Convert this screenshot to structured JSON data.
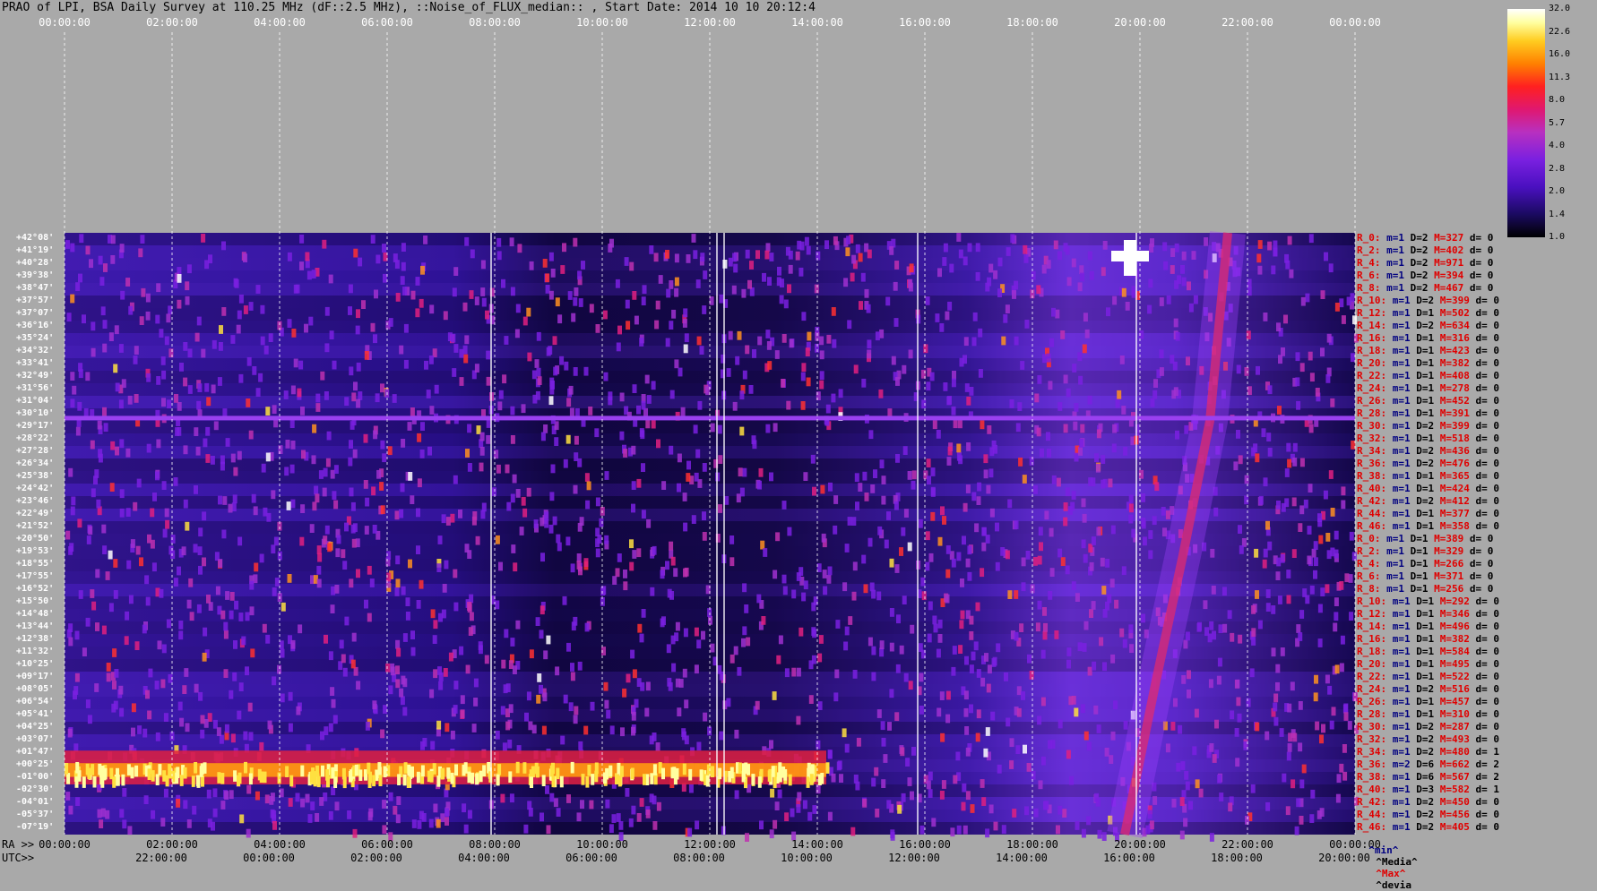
{
  "title": "PRAO of LPI, BSA Daily Survey at 110.25 MHz (dF::2.5 MHz), ::Noise_of_FLUX_median:: , Start Date: 2014 10 10 20:12:4",
  "chart_data": {
    "type": "heatmap",
    "title": "PRAO of LPI, BSA Daily Survey at 110.25 MHz (dF::2.5 MHz), ::Noise_of_FLUX_median:: , Start Date: 2014 10 10 20:12:4",
    "x_top_ticks": [
      "00:00:00",
      "02:00:00",
      "04:00:00",
      "06:00:00",
      "08:00:00",
      "10:00:00",
      "12:00:00",
      "14:00:00",
      "16:00:00",
      "18:00:00",
      "20:00:00",
      "22:00:00",
      "00:00:00"
    ],
    "x_ra_label": "RA >>",
    "x_ra_ticks": [
      "00:00:00",
      "02:00:00",
      "04:00:00",
      "06:00:00",
      "08:00:00",
      "10:00:00",
      "12:00:00",
      "14:00:00",
      "16:00:00",
      "18:00:00",
      "20:00:00",
      "22:00:00",
      "00:00:00"
    ],
    "x_utc_label": "UTC>>",
    "x_utc_ticks": [
      "22:00:00",
      "00:00:00",
      "02:00:00",
      "04:00:00",
      "06:00:00",
      "08:00:00",
      "10:00:00",
      "12:00:00",
      "14:00:00",
      "16:00:00",
      "18:00:00",
      "20:00:00"
    ],
    "y_dec_ticks": [
      "+42°08'",
      "+41°19'",
      "+40°28'",
      "+39°38'",
      "+38°47'",
      "+37°57'",
      "+37°07'",
      "+36°16'",
      "+35°24'",
      "+34°32'",
      "+33°41'",
      "+32°49'",
      "+31°56'",
      "+31°04'",
      "+30°10'",
      "+29°17'",
      "+28°22'",
      "+27°28'",
      "+26°34'",
      "+25°38'",
      "+24°42'",
      "+23°46'",
      "+22°49'",
      "+21°52'",
      "+20°50'",
      "+19°53'",
      "+18°55'",
      "+17°55'",
      "+16°52'",
      "+15°50'",
      "+14°48'",
      "+13°44'",
      "+12°38'",
      "+11°32'",
      "+10°25'",
      "+09°17'",
      "+08°05'",
      "+06°54'",
      "+05°41'",
      "+04°25'",
      "+03°07'",
      "+01°47'",
      "+00°25'",
      "-01°00'",
      "-02°30'",
      "-04°01'",
      "-05°37'",
      "-07°19'"
    ],
    "colorbar": {
      "ticks": [
        "32.0",
        "22.6",
        "16.0",
        "11.3",
        "8.0",
        "5.7",
        "4.0",
        "2.8",
        "2.0",
        "1.4",
        "1.0"
      ],
      "scale": "log"
    },
    "rows": [
      {
        "name": "R_0:",
        "m": "m=1",
        "d": "D=2",
        "max": "M=327",
        "dev": "d= 0"
      },
      {
        "name": "R_2:",
        "m": "m=1",
        "d": "D=2",
        "max": "M=402",
        "dev": "d= 0"
      },
      {
        "name": "R_4:",
        "m": "m=1",
        "d": "D=2",
        "max": "M=971",
        "dev": "d= 0"
      },
      {
        "name": "R_6:",
        "m": "m=1",
        "d": "D=2",
        "max": "M=394",
        "dev": "d= 0"
      },
      {
        "name": "R_8:",
        "m": "m=1",
        "d": "D=2",
        "max": "M=467",
        "dev": "d= 0"
      },
      {
        "name": "R_10:",
        "m": "m=1",
        "d": "D=2",
        "max": "M=399",
        "dev": "d= 0"
      },
      {
        "name": "R_12:",
        "m": "m=1",
        "d": "D=1",
        "max": "M=502",
        "dev": "d= 0"
      },
      {
        "name": "R_14:",
        "m": "m=1",
        "d": "D=2",
        "max": "M=634",
        "dev": "d= 0"
      },
      {
        "name": "R_16:",
        "m": "m=1",
        "d": "D=1",
        "max": "M=316",
        "dev": "d= 0"
      },
      {
        "name": "R_18:",
        "m": "m=1",
        "d": "D=1",
        "max": "M=423",
        "dev": "d= 0"
      },
      {
        "name": "R_20:",
        "m": "m=1",
        "d": "D=1",
        "max": "M=382",
        "dev": "d= 0"
      },
      {
        "name": "R_22:",
        "m": "m=1",
        "d": "D=1",
        "max": "M=408",
        "dev": "d= 0"
      },
      {
        "name": "R_24:",
        "m": "m=1",
        "d": "D=1",
        "max": "M=278",
        "dev": "d= 0"
      },
      {
        "name": "R_26:",
        "m": "m=1",
        "d": "D=1",
        "max": "M=452",
        "dev": "d= 0"
      },
      {
        "name": "R_28:",
        "m": "m=1",
        "d": "D=1",
        "max": "M=391",
        "dev": "d= 0"
      },
      {
        "name": "R_30:",
        "m": "m=1",
        "d": "D=2",
        "max": "M=399",
        "dev": "d= 0"
      },
      {
        "name": "R_32:",
        "m": "m=1",
        "d": "D=1",
        "max": "M=518",
        "dev": "d= 0"
      },
      {
        "name": "R_34:",
        "m": "m=1",
        "d": "D=2",
        "max": "M=436",
        "dev": "d= 0"
      },
      {
        "name": "R_36:",
        "m": "m=1",
        "d": "D=2",
        "max": "M=476",
        "dev": "d= 0"
      },
      {
        "name": "R_38:",
        "m": "m=1",
        "d": "D=1",
        "max": "M=365",
        "dev": "d= 0"
      },
      {
        "name": "R_40:",
        "m": "m=1",
        "d": "D=1",
        "max": "M=424",
        "dev": "d= 0"
      },
      {
        "name": "R_42:",
        "m": "m=1",
        "d": "D=2",
        "max": "M=412",
        "dev": "d= 0"
      },
      {
        "name": "R_44:",
        "m": "m=1",
        "d": "D=1",
        "max": "M=377",
        "dev": "d= 0"
      },
      {
        "name": "R_46:",
        "m": "m=1",
        "d": "D=1",
        "max": "M=358",
        "dev": "d= 0"
      },
      {
        "name": "R_0:",
        "m": "m=1",
        "d": "D=1",
        "max": "M=389",
        "dev": "d= 0"
      },
      {
        "name": "R_2:",
        "m": "m=1",
        "d": "D=1",
        "max": "M=329",
        "dev": "d= 0"
      },
      {
        "name": "R_4:",
        "m": "m=1",
        "d": "D=1",
        "max": "M=266",
        "dev": "d= 0"
      },
      {
        "name": "R_6:",
        "m": "m=1",
        "d": "D=1",
        "max": "M=371",
        "dev": "d= 0"
      },
      {
        "name": "R_8:",
        "m": "m=1",
        "d": "D=1",
        "max": "M=256",
        "dev": "d= 0"
      },
      {
        "name": "R_10:",
        "m": "m=1",
        "d": "D=1",
        "max": "M=292",
        "dev": "d= 0"
      },
      {
        "name": "R_12:",
        "m": "m=1",
        "d": "D=1",
        "max": "M=346",
        "dev": "d= 0"
      },
      {
        "name": "R_14:",
        "m": "m=1",
        "d": "D=1",
        "max": "M=496",
        "dev": "d= 0"
      },
      {
        "name": "R_16:",
        "m": "m=1",
        "d": "D=1",
        "max": "M=382",
        "dev": "d= 0"
      },
      {
        "name": "R_18:",
        "m": "m=1",
        "d": "D=1",
        "max": "M=584",
        "dev": "d= 0"
      },
      {
        "name": "R_20:",
        "m": "m=1",
        "d": "D=1",
        "max": "M=495",
        "dev": "d= 0"
      },
      {
        "name": "R_22:",
        "m": "m=1",
        "d": "D=1",
        "max": "M=522",
        "dev": "d= 0"
      },
      {
        "name": "R_24:",
        "m": "m=1",
        "d": "D=2",
        "max": "M=516",
        "dev": "d= 0"
      },
      {
        "name": "R_26:",
        "m": "m=1",
        "d": "D=1",
        "max": "M=457",
        "dev": "d= 0"
      },
      {
        "name": "R_28:",
        "m": "m=1",
        "d": "D=1",
        "max": "M=310",
        "dev": "d= 0"
      },
      {
        "name": "R_30:",
        "m": "m=1",
        "d": "D=2",
        "max": "M=287",
        "dev": "d= 0"
      },
      {
        "name": "R_32:",
        "m": "m=1",
        "d": "D=2",
        "max": "M=493",
        "dev": "d= 0"
      },
      {
        "name": "R_34:",
        "m": "m=1",
        "d": "D=2",
        "max": "M=480",
        "dev": "d= 1"
      },
      {
        "name": "R_36:",
        "m": "m=2",
        "d": "D=6",
        "max": "M=662",
        "dev": "d= 2"
      },
      {
        "name": "R_38:",
        "m": "m=1",
        "d": "D=6",
        "max": "M=567",
        "dev": "d= 2"
      },
      {
        "name": "R_40:",
        "m": "m=1",
        "d": "D=3",
        "max": "M=582",
        "dev": "d= 1"
      },
      {
        "name": "R_42:",
        "m": "m=1",
        "d": "D=2",
        "max": "M=450",
        "dev": "d= 0"
      },
      {
        "name": "R_44:",
        "m": "m=1",
        "d": "D=2",
        "max": "M=456",
        "dev": "d= 0"
      },
      {
        "name": "R_46:",
        "m": "m=1",
        "d": "D=2",
        "max": "M=405",
        "dev": "d= 0"
      }
    ],
    "legend": {
      "min": "^min^",
      "media": "^Media^",
      "max": "^Max^",
      "devia": "^devia"
    }
  }
}
